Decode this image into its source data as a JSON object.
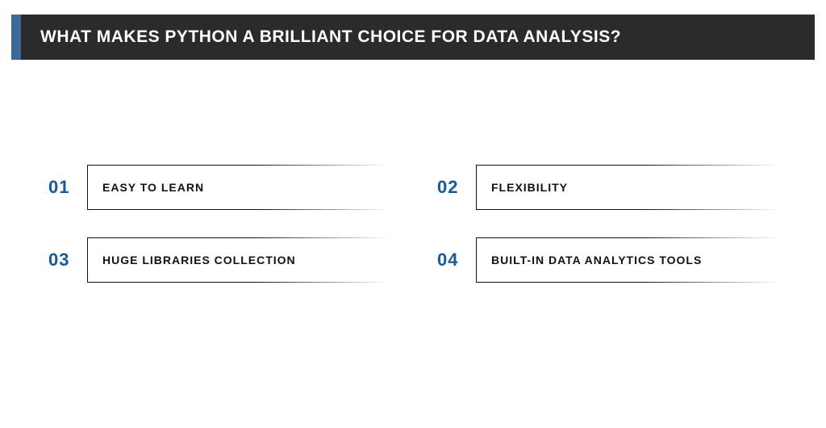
{
  "header": {
    "title": "WHAT MAKES PYTHON A BRILLIANT CHOICE FOR DATA ANALYSIS?"
  },
  "items": [
    {
      "number": "01",
      "label": "EASY TO LEARN"
    },
    {
      "number": "02",
      "label": "FLEXIBILITY"
    },
    {
      "number": "03",
      "label": "HUGE LIBRARIES COLLECTION"
    },
    {
      "number": "04",
      "label": "BUILT-IN DATA ANALYTICS TOOLS"
    }
  ],
  "colors": {
    "accent": "#3b6a99",
    "headerBg": "#2b2b2b",
    "numberColor": "#155a9c"
  }
}
